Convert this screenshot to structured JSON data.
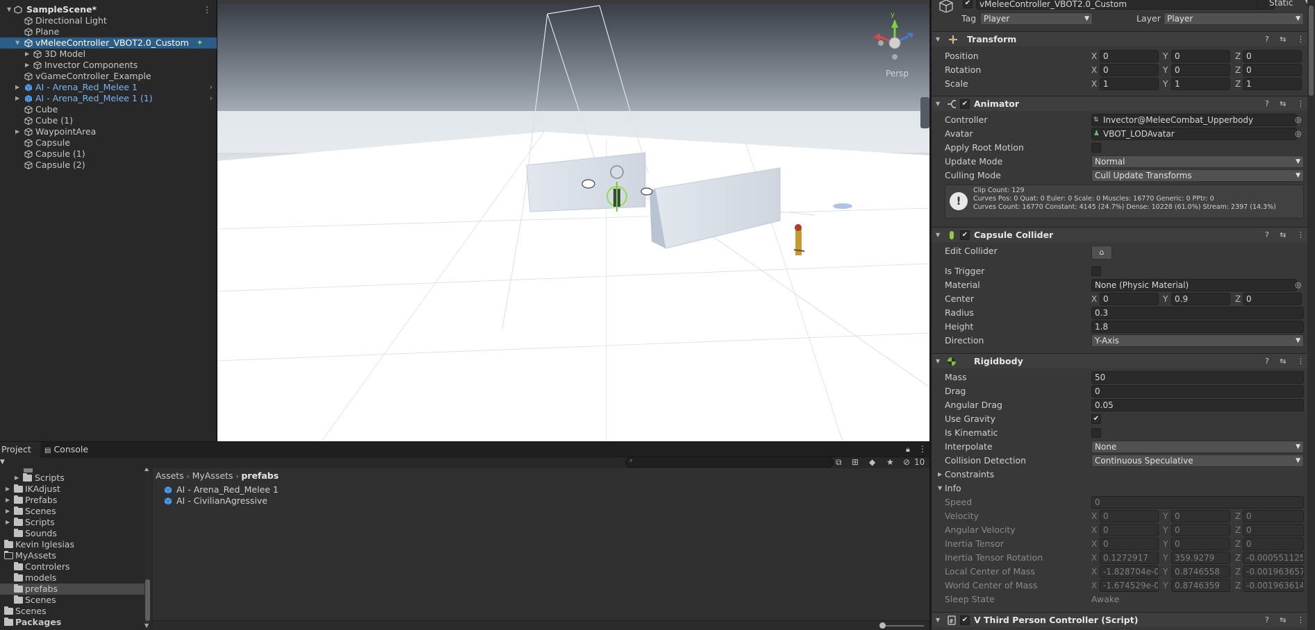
{
  "hierarchy": {
    "scene_name": "SampleScene*",
    "items": [
      {
        "label": "Directional Light",
        "type": "object"
      },
      {
        "label": "Plane",
        "type": "object"
      },
      {
        "label": "vMeleeController_VBOT2.0_Custom",
        "type": "object"
      },
      {
        "label": "3D Model",
        "type": "object"
      },
      {
        "label": "Invector Components",
        "type": "object"
      },
      {
        "label": "vGameController_Example",
        "type": "object"
      },
      {
        "label": "AI - Arena_Red_Melee 1",
        "type": "prefab"
      },
      {
        "label": "AI - Arena_Red_Melee 1 (1)",
        "type": "prefab"
      },
      {
        "label": "Cube",
        "type": "object"
      },
      {
        "label": "Cube (1)",
        "type": "object"
      },
      {
        "label": "WaypointArea",
        "type": "object"
      },
      {
        "label": "Capsule",
        "type": "object"
      },
      {
        "label": "Capsule (1)",
        "type": "object"
      },
      {
        "label": "Capsule (2)",
        "type": "object"
      }
    ]
  },
  "scene": {
    "persp_label": "Persp",
    "gizmo_y": "y",
    "colors": {
      "sky_top": "#353a42",
      "horizon": "#dfe4ea",
      "ground": "#ffffff"
    }
  },
  "inspector": {
    "object_name": "vMeleeController_VBOT2.0_Custom",
    "static_label": "Static",
    "tag_label": "Tag",
    "tag_value": "Player",
    "layer_label": "Layer",
    "layer_value": "Player",
    "transform": {
      "title": "Transform",
      "position": {
        "label": "Position",
        "x": "0",
        "y": "0",
        "z": "0"
      },
      "rotation": {
        "label": "Rotation",
        "x": "0",
        "y": "0",
        "z": "0"
      },
      "scale": {
        "label": "Scale",
        "x": "1",
        "y": "1",
        "z": "1"
      }
    },
    "animator": {
      "title": "Animator",
      "controller_label": "Controller",
      "controller_value": "Invector@MeleeCombat_Upperbody",
      "avatar_label": "Avatar",
      "avatar_value": "VBOT_LODAvatar",
      "apply_root_motion_label": "Apply Root Motion",
      "update_mode_label": "Update Mode",
      "update_mode_value": "Normal",
      "culling_mode_label": "Culling Mode",
      "culling_mode_value": "Cull Update Transforms",
      "info_line1": "Clip Count: 129",
      "info_line2": "Curves Pos: 0 Quat: 0 Euler: 0 Scale: 0 Muscles: 16770 Generic: 0 PPtr: 0",
      "info_line3": "Curves Count: 16770 Constant: 4145 (24.7%) Dense: 10228 (61.0%) Stream: 2397 (14.3%)"
    },
    "capsule": {
      "title": "Capsule Collider",
      "edit_collider_label": "Edit Collider",
      "is_trigger_label": "Is Trigger",
      "material_label": "Material",
      "material_value": "None (Physic Material)",
      "center_label": "Center",
      "center": {
        "x": "0",
        "y": "0.9",
        "z": "0"
      },
      "radius_label": "Radius",
      "radius_value": "0.3",
      "height_label": "Height",
      "height_value": "1.8",
      "direction_label": "Direction",
      "direction_value": "Y-Axis"
    },
    "rigidbody": {
      "title": "Rigidbody",
      "mass_label": "Mass",
      "mass_value": "50",
      "drag_label": "Drag",
      "drag_value": "0",
      "angular_drag_label": "Angular Drag",
      "angular_drag_value": "0.05",
      "use_gravity_label": "Use Gravity",
      "is_kinematic_label": "Is Kinematic",
      "interpolate_label": "Interpolate",
      "interpolate_value": "None",
      "collision_label": "Collision Detection",
      "collision_value": "Continuous Speculative",
      "constraints_label": "Constraints",
      "info_label": "Info",
      "speed_label": "Speed",
      "speed_value": "0",
      "velocity_label": "Velocity",
      "velocity": {
        "x": "0",
        "y": "0",
        "z": "0"
      },
      "angular_velocity_label": "Angular Velocity",
      "angular_velocity": {
        "x": "0",
        "y": "0",
        "z": "0"
      },
      "inertia_tensor_label": "Inertia Tensor",
      "inertia_tensor": {
        "x": "0",
        "y": "0",
        "z": "0"
      },
      "inertia_rot_label": "Inertia Tensor Rotation",
      "inertia_rot": {
        "x": "0.1272917",
        "y": "359.9279",
        "z": "-0.000551125"
      },
      "local_com_label": "Local Center of Mass",
      "local_com": {
        "x": "-1.828704e-0",
        "y": "0.8746558",
        "z": "-0.001963657"
      },
      "world_com_label": "World Center of Mass",
      "world_com": {
        "x": "-1.674529e-0",
        "y": "0.8746359",
        "z": "-0.001963614"
      },
      "sleep_label": "Sleep State",
      "sleep_value": "Awake"
    },
    "script": {
      "title": "V Third Person Controller (Script)"
    },
    "axis_x": "X",
    "axis_y": "Y",
    "axis_z": "Z"
  },
  "project": {
    "tab_project": "Project",
    "tab_console": "Console",
    "hidden_count": "10",
    "tree": [
      {
        "label": "Scripts"
      },
      {
        "label": "IKAdjust"
      },
      {
        "label": "Prefabs"
      },
      {
        "label": "Scenes"
      },
      {
        "label": "Scripts"
      },
      {
        "label": "Sounds"
      },
      {
        "label": "Kevin Iglesias"
      },
      {
        "label": "MyAssets"
      },
      {
        "label": "Controlers"
      },
      {
        "label": "models"
      },
      {
        "label": "prefabs"
      },
      {
        "label": "Scenes"
      },
      {
        "label": "Scenes"
      },
      {
        "label": "Packages"
      }
    ],
    "breadcrumb": {
      "a": "Assets",
      "b": "MyAssets",
      "c": "prefabs"
    },
    "assets": [
      {
        "label": "AI - Arena_Red_Melee 1"
      },
      {
        "label": "AI - CivilianAgressive"
      }
    ]
  }
}
